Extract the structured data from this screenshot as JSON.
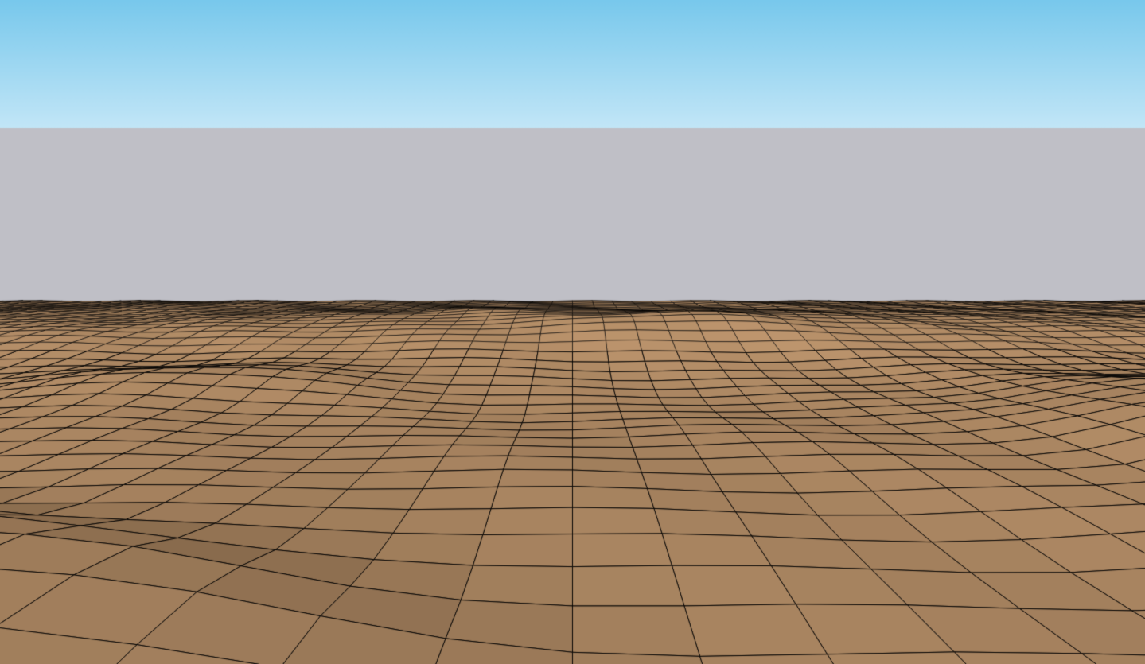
{
  "scene": {
    "type": "3d-modeling-viewport",
    "colors": {
      "sky_top": "#78c8ec",
      "sky_bottom": "#c2e6f7",
      "ground_plane": "#bfbfc6",
      "terrain_light": "#d2a67a",
      "terrain_dark": "#7a5f44",
      "edge_lines": "#000000"
    }
  }
}
